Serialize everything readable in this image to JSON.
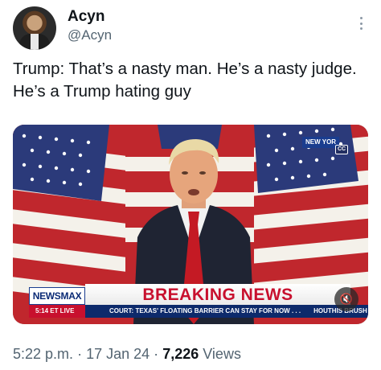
{
  "author": {
    "name": "Acyn",
    "handle": "@Acyn"
  },
  "tweet": {
    "text": "Trump: That’s a nasty man. He’s a nasty judge. He’s a Trump hating guy"
  },
  "video": {
    "network_tag": "NEW YOR",
    "cc_label": "CC",
    "channel_logo": "NEWSMAX",
    "banner": "BREAKING NEWS",
    "time_label": "5:14 ET  LIVE",
    "ticker_text": "COURT: TEXAS' FLOATING BARRIER CAN STAY FOR NOW . . .",
    "ticker_text_2": "HOUTHIS BRUSH OF",
    "mute_icon": "speaker-muted-icon"
  },
  "meta": {
    "time": "5:22 p.m.",
    "date": "17 Jan 24",
    "separator": "·",
    "views_count": "7,226",
    "views_label": "Views"
  },
  "colors": {
    "text_primary": "#0f1419",
    "text_secondary": "#536471",
    "banner_red": "#c8102e",
    "ticker_navy": "#0d2a6b"
  }
}
